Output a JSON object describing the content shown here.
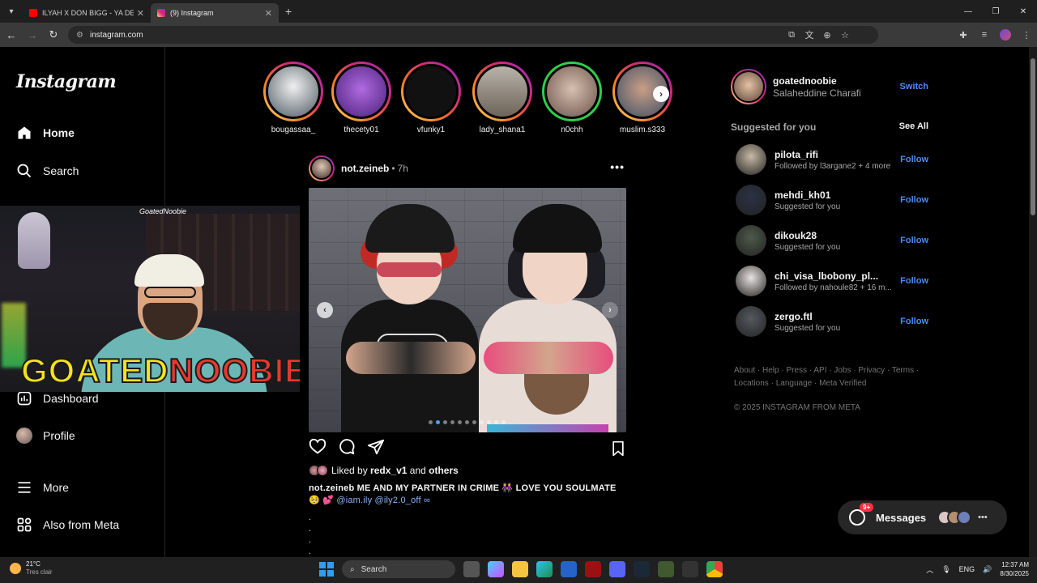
{
  "browser": {
    "tabs": [
      {
        "title": "ILYAH X DON BIGG - YA DELLAL",
        "color": "#ff0000"
      },
      {
        "title": "(9) Instagram",
        "color": "#d62976"
      }
    ],
    "url": "instagram.com"
  },
  "sidebar": {
    "logo": "Instagram",
    "items": [
      {
        "label": "Home",
        "icon": "home-icon"
      },
      {
        "label": "Search",
        "icon": "search-icon"
      },
      {
        "label": "Dashboard",
        "icon": "dashboard-icon"
      },
      {
        "label": "Profile",
        "icon": "profile-avatar"
      },
      {
        "label": "More",
        "icon": "menu-icon"
      },
      {
        "label": "Also from Meta",
        "icon": "meta-apps-icon"
      }
    ]
  },
  "overlay": {
    "handle": "GoatedNoobie",
    "brand_part1": "GOATED",
    "brand_part2": "NOOBIE"
  },
  "stories": [
    {
      "name": "bougassaa_",
      "ring": "gradient",
      "color": "#cfd6da"
    },
    {
      "name": "thecety01",
      "ring": "gradient",
      "color": "#8a3fd1"
    },
    {
      "name": "vfunky1",
      "ring": "gradient",
      "color": "#111111"
    },
    {
      "name": "lady_shana1",
      "ring": "gradient",
      "color": "#9a8e80"
    },
    {
      "name": "n0chh",
      "ring": "green",
      "color": "#b89b8b"
    },
    {
      "name": "muslim.s333",
      "ring": "gradient",
      "color": "#6e85a0"
    }
  ],
  "post": {
    "user": "not.zeineb",
    "time": "7h",
    "liked_prefix": "Liked by",
    "liked_user": "redx_v1",
    "liked_and": "and",
    "liked_others": "others",
    "caption_user": "not.zeineb",
    "caption_text": "ME AND MY PARTNER IN CRIME 👭 LOVE YOU SOULMATE",
    "caption_emoji": "🥺 💕",
    "mentions": "@iam.ily @ily2.0_off ∞",
    "carousel_count": 11,
    "carousel_index": 1
  },
  "right": {
    "me_user": "goatednoobie",
    "me_name": "Salaheddine Charafi",
    "switch_label": "Switch",
    "suggested_label": "Suggested for you",
    "see_all_label": "See All",
    "follow_label": "Follow",
    "suggestions": [
      {
        "user": "pilota_rifi",
        "sub": "Followed by l3argane2 + 4 more",
        "color": "#c7b9a5"
      },
      {
        "user": "mehdi_kh01",
        "sub": "Suggested for you",
        "color": "#2c3244"
      },
      {
        "user": "dikouk28",
        "sub": "Suggested for you",
        "color": "#4d5a4a"
      },
      {
        "user": "chi_visa_lbobony_pl...",
        "sub": "Followed by nahoule82 + 16 m...",
        "color": "#e9e2e2"
      },
      {
        "user": "zergo.ftl",
        "sub": "Suggested for you",
        "color": "#555a60"
      }
    ],
    "footer_line1": "About · Help · Press · API · Jobs · Privacy · Terms ·",
    "footer_line2": "Locations · Language · Meta Verified",
    "copyright": "© 2025 INSTAGRAM FROM META"
  },
  "messages": {
    "label": "Messages",
    "badge": "9+"
  },
  "taskbar": {
    "temp": "21°C",
    "condition": "Tres clair",
    "search_placeholder": "Search",
    "lang": "ENG",
    "time": "12:37 AM",
    "date": "8/30/2025"
  }
}
